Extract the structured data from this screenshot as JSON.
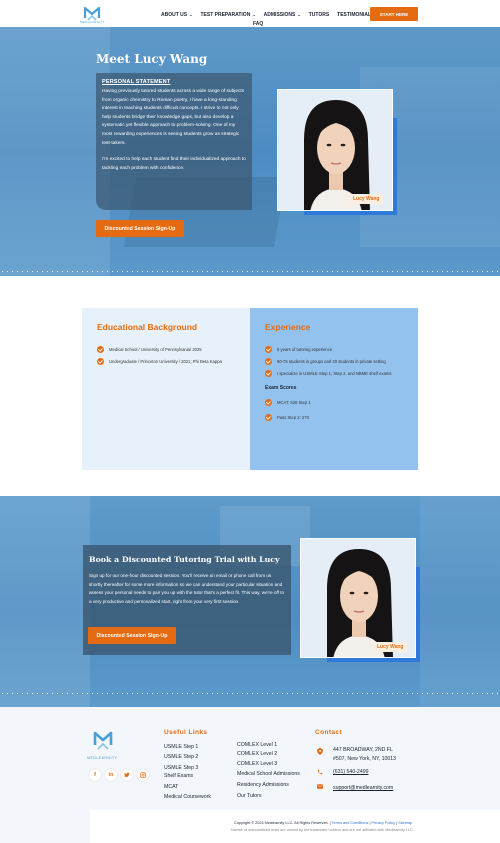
{
  "nav": {
    "logo_text": "MEDLEARNITY",
    "items": [
      {
        "label": "ABOUT US",
        "has_dropdown": true
      },
      {
        "label": "TEST PREPARATION",
        "has_dropdown": true
      },
      {
        "label": "ADMISSIONS",
        "has_dropdown": true
      },
      {
        "label": "TUTORS",
        "has_dropdown": false
      },
      {
        "label": "TESTIMONIALS",
        "has_dropdown": false
      }
    ],
    "faq": "FAQ",
    "cta": "START HERE",
    "dropdown_icon": "chevron-down-icon"
  },
  "hero": {
    "title": "Meet Lucy Wang",
    "statement_heading": "PERSONAL STATEMENT",
    "statement_p1": "Having previously tutored students across a wide range of subjects from organic chemistry to Roman poetry, I have a long-standing interest in teaching students difficult concepts. I strive to not only help students bridge their knowledge gaps, but also develop a systematic yet flexible approach to problem-solving. One of my most rewarding experiences is seeing students grow as strategic test-takers.",
    "statement_p2": "I'm excited to help each student find their individualized approach to tackling each problem with confidence.",
    "button": "Discounted Session Sign-Up",
    "name_tag": "Lucy Wang"
  },
  "education": {
    "title": "Educational Background",
    "items": [
      "Medical School / University of Pennsylvania/ 2025",
      "Undergraduate / Princeton University / 2021; Phi Beta Kappa"
    ]
  },
  "experience": {
    "title": "Experience",
    "items": [
      "6 years of tutoring experience",
      "50-75 students in groups and 20 students in private setting",
      "I specialize in USMLE Step 1, Step 2, and NBME shelf exams"
    ],
    "exam_title": "Exam Scores",
    "scores": [
      "MCAT: 528 Step 1",
      "Pass Step 2: 270"
    ]
  },
  "trial": {
    "title": "Book a Discounted Tutoring Trial with Lucy",
    "text": "Sign up for our one-hour discounted session. You'll receive an email or phone call from us shortly thereafter for some more information so we can understand your particular situation and assess your personal needs to pair you up with the tutor that's a perfect fit. This way, we're off to a very productive and personalized start, right from your very first session.",
    "button": "Discounted Session Sign-Up",
    "name_tag": "Lucy Wang"
  },
  "footer": {
    "logo_text": "MEDLEARNITY",
    "useful_links_heading": "Useful Links",
    "links_col1": [
      "USMLE Step 1",
      "USMLE Step 2",
      "USMLE Step 3",
      "Shelf Exams",
      "MCAT",
      "Medical Coursework"
    ],
    "links_col2": [
      "COMLEX Level 1",
      "COMLEX Level 2",
      "COMLEX Level 3",
      "Medical School Admissions",
      "Residency Admissions",
      "Our Tutors"
    ],
    "contact_heading": "Contact",
    "address_line1": "447 BROADWAY, 2ND FL",
    "address_line2": "#507, New York, NY, 10013",
    "phone": "(631) 540-2499",
    "email": "support@medlearnity.com",
    "socials": [
      "facebook-icon",
      "linkedin-icon",
      "twitter-icon",
      "instagram-icon"
    ],
    "copyright": "Copyright © 2024 Medlearnity LLC. All Rights Reserved. |",
    "terms": "Terms and Conditions",
    "privacy": "Privacy Policy",
    "sitemap": "Sitemap",
    "disclaimer": "Names of standardized tests are owned by the trademark holders and are not affiliated with Medlearnity LLC."
  },
  "colors": {
    "accent": "#e46b11",
    "brand_blue": "#4a9fd8",
    "hero_blue": "#5596c8",
    "edu_bg": "#e6f1fb",
    "exp_bg": "#94c2ef"
  }
}
